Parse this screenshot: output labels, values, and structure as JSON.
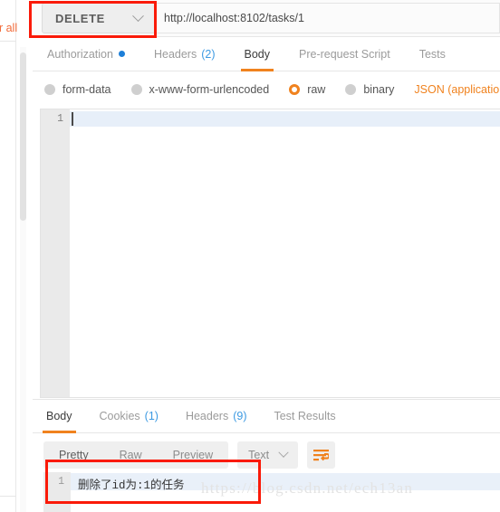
{
  "left_panel": {
    "clear_all_label": "ar all"
  },
  "url_bar": {
    "method": "DELETE",
    "method_chevron_icon": "chevron-down-icon",
    "url": "http://localhost:8102/tasks/1"
  },
  "request_tabs": [
    {
      "label": "Authorization",
      "active": false,
      "has_dot": true,
      "count": ""
    },
    {
      "label": "Headers",
      "active": false,
      "has_dot": false,
      "count": "(2)"
    },
    {
      "label": "Body",
      "active": true,
      "has_dot": false,
      "count": ""
    },
    {
      "label": "Pre-request Script",
      "active": false,
      "has_dot": false,
      "count": ""
    },
    {
      "label": "Tests",
      "active": false,
      "has_dot": false,
      "count": ""
    }
  ],
  "body_types": [
    {
      "label": "form-data",
      "selected": false
    },
    {
      "label": "x-www-form-urlencoded",
      "selected": false
    },
    {
      "label": "raw",
      "selected": true
    },
    {
      "label": "binary",
      "selected": false
    }
  ],
  "body_content_type": "JSON (application",
  "request_editor": {
    "line_number": "1",
    "content": ""
  },
  "response_tabs": [
    {
      "label": "Body",
      "active": true,
      "count": ""
    },
    {
      "label": "Cookies",
      "active": false,
      "count": "(1)"
    },
    {
      "label": "Headers",
      "active": false,
      "count": "(9)"
    },
    {
      "label": "Test Results",
      "active": false,
      "count": ""
    }
  ],
  "response_toolbar": {
    "view_modes": [
      {
        "label": "Pretty",
        "active": true
      },
      {
        "label": "Raw",
        "active": false
      },
      {
        "label": "Preview",
        "active": false
      }
    ],
    "format": "Text",
    "format_chevron_icon": "chevron-down-icon",
    "wrap_icon": "word-wrap-icon"
  },
  "response_body": {
    "line_number": "1",
    "text": "删除了id为:1的任务"
  },
  "watermark": "https://blog.csdn.net/ech13an",
  "annotations": {
    "method_box": "red-highlight-method",
    "response_box": "red-highlight-response"
  },
  "colors": {
    "accent_orange": "#f0821e",
    "link_blue": "#3d9ae2",
    "annotation_red": "#fa1a09",
    "dot_blue": "#1d7fd8"
  }
}
